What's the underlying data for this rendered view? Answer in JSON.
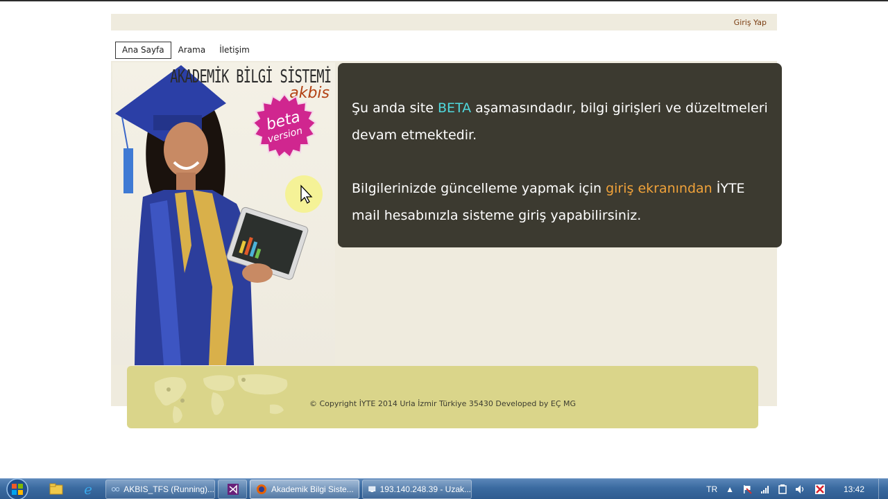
{
  "header": {
    "login_label": "Giriş Yap"
  },
  "nav": {
    "items": [
      {
        "label": "Ana Sayfa",
        "active": true
      },
      {
        "label": "Arama",
        "active": false
      },
      {
        "label": "İletişim",
        "active": false
      }
    ]
  },
  "hero": {
    "title": "AKADEMİK BİLGİ SİSTEMİ",
    "subtitle": "akbis",
    "badge_line1": "beta",
    "badge_line2": "version"
  },
  "notice": {
    "p1_before": "Şu anda site ",
    "p1_highlight": "BETA",
    "p1_after": " aşamasındadır, bilgi girişleri ve düzeltmeleri devam etmektedir.",
    "p2_before": "Bilgilerinizde güncelleme yapmak için ",
    "p2_highlight": "giriş ekranından",
    "p2_after": " İYTE mail hesabınızla sisteme giriş yapabilirsiniz."
  },
  "footer": {
    "copyright": "© Copyright İYTE 2014 Urla İzmir Türkiye 35430 Developed by EÇ MG"
  },
  "taskbar": {
    "tasks": [
      {
        "label": "AKBIS_TFS (Running)...",
        "icon": "virtualbox-icon"
      },
      {
        "label": "",
        "icon": "visual-studio-icon"
      },
      {
        "label": "Akademik Bilgi Siste...",
        "icon": "firefox-icon"
      },
      {
        "label": "193.140.248.39 - Uzak...",
        "icon": "remote-desktop-icon"
      }
    ],
    "language": "TR",
    "clock": "13:42"
  },
  "colors": {
    "notice_bg": "#3c3a30",
    "beta_highlight": "#4fd9de",
    "login_highlight": "#f0a23a",
    "footer_bg": "#dad58a",
    "page_bg": "#efebde",
    "badge": "#d0268f"
  }
}
